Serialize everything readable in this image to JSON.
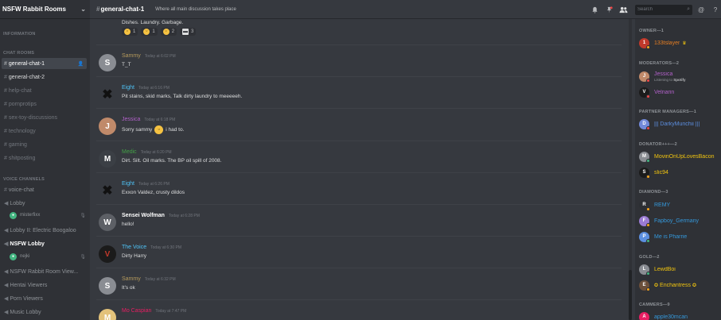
{
  "server": {
    "name": "NSFW Rabbit Rooms"
  },
  "sidebar": {
    "categories": {
      "information": "INFORMATION",
      "chat": "CHAT ROOMS",
      "voice": "VOICE CHANNELS"
    },
    "text_channels": [
      "general-chat-1",
      "general-chat-2",
      "help-chat",
      "pornprotips",
      "sex-toy-discussions",
      "technology",
      "gaming",
      "shitposting"
    ],
    "voice_channels": [
      "voice-chat",
      "Lobby",
      "Lobby II: Electric Boogaloo",
      "NSFW Lobby",
      "NSFW Rabbit Room View...",
      "Hentai Viewers",
      "Porn Viewers",
      "Music Lobby"
    ],
    "voice_users": [
      "misterfixx",
      "nejki"
    ]
  },
  "header": {
    "channel": "general-chat-1",
    "topic": "Where all main discussion takes place",
    "search_placeholder": "Search"
  },
  "top_message": {
    "text": "Dishes. Laundry. Garbage.",
    "reactions": [
      {
        "emoji": "drool-face",
        "count": "1"
      },
      {
        "emoji": "grin-face",
        "count": "1"
      },
      {
        "emoji": "sweat-smile-face",
        "count": "2"
      },
      {
        "emoji": "trashcan",
        "count": "3"
      }
    ]
  },
  "messages": [
    {
      "author": "Sammy",
      "color": "#b59a5c",
      "time": "Today at 6:02 PM",
      "text": "T_T"
    },
    {
      "author": "Eight",
      "color": "#4fc3f7",
      "time": "Today at 6:16 PM",
      "text": "Pit stains, skid marks, Talk dirty laundry to meeeeeh."
    },
    {
      "author": "Jessica",
      "color": "#b161c9",
      "time": "Today at 6:18 PM",
      "text": "Sorry sammy",
      "text_after": "i had to."
    },
    {
      "author": "Medic",
      "color": "#43a047",
      "time": "Today at 6:20 PM",
      "text": "Dirt. Silt. Oil marks. The BP oil spill of 2008."
    },
    {
      "author": "Eight",
      "color": "#4fc3f7",
      "time": "Today at 6:26 PM",
      "text": "Exxon Valdez, crusty dildos"
    },
    {
      "author": "Sensei Wolfman",
      "color": "#ffffff",
      "time": "Today at 6:28 PM",
      "text": "hello!"
    },
    {
      "author": "The Voice",
      "color": "#4fc3f7",
      "time": "Today at 6:30 PM",
      "text": "Dirty Harry"
    },
    {
      "author": "Sammy",
      "color": "#b59a5c",
      "time": "Today at 6:32 PM",
      "text": "It's ok"
    },
    {
      "author": "Mo Caspian",
      "color": "#e91e63",
      "time": "Today at 7:47 PM",
      "text": ""
    }
  ],
  "members": {
    "owner": {
      "title": "OWNER—1",
      "list": [
        {
          "name": "133tslayer",
          "color": "#e67e22",
          "crown": "♛"
        }
      ]
    },
    "moderators": {
      "title": "MODERATORS—2",
      "list": [
        {
          "name": "Jessica",
          "color": "#b161c9",
          "activity_prefix": "Listening to",
          "activity": "Spotify"
        },
        {
          "name": "Velnarin",
          "color": "#b161c9"
        }
      ]
    },
    "partners": {
      "title": "PARTNER MANAGERS—1",
      "list": [
        {
          "name": "||| DarkyMunchii |||",
          "color": "#5c8fe0"
        }
      ]
    },
    "donators": {
      "title": "DONATOR+++—2",
      "list": [
        {
          "name": "MovinOnUpLovesBacon",
          "color": "#f1c40f"
        },
        {
          "name": "slic94",
          "color": "#f1c40f"
        }
      ]
    },
    "diamond": {
      "title": "DIAMOND—3",
      "list": [
        {
          "name": "REMY",
          "color": "#3498db"
        },
        {
          "name": "Fapboy_Germany",
          "color": "#3498db"
        },
        {
          "name": "Me is Pharrie",
          "color": "#3498db"
        }
      ]
    },
    "gold": {
      "title": "GOLD—2",
      "list": [
        {
          "name": "LewdBoi",
          "color": "#f1c40f"
        },
        {
          "name": "Enchantress",
          "color": "#f1c40f",
          "flair": "✪"
        }
      ]
    },
    "cammers": {
      "title": "CAMMERS—9",
      "list": [
        {
          "name": "apple30mcan",
          "color": "#3498db"
        }
      ]
    }
  },
  "colors": {
    "online": "#43b581",
    "idle": "#faa61a",
    "dnd": "#f04747",
    "accent": "#7289da"
  }
}
